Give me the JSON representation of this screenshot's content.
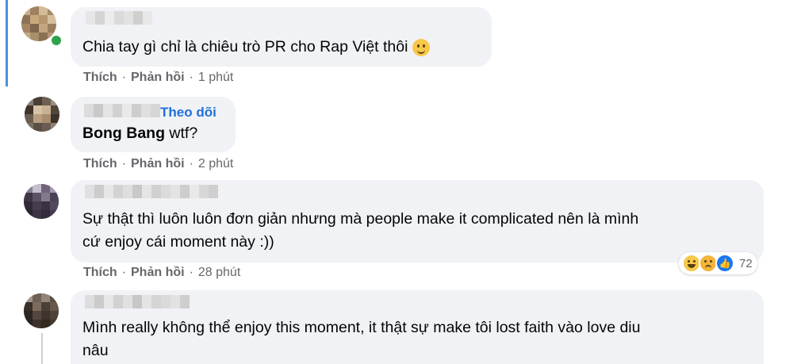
{
  "comments": [
    {
      "text": "Chia tay gì chỉ là chiêu trò PR cho Rap Việt thôi",
      "emoji": "slightly-smiling-face",
      "like": "Thích",
      "reply": "Phản hồi",
      "time": "1 phút"
    },
    {
      "follow": "Theo dõi",
      "mention": "Bong Bang",
      "text": " wtf?",
      "like": "Thích",
      "reply": "Phản hồi",
      "time": "2 phút"
    },
    {
      "line1": "Sự thật thì luôn luôn đơn giản nhưng mà people make it complicated nên là mình",
      "line2": "cứ enjoy cái moment này :))",
      "like": "Thích",
      "reply": "Phản hồi",
      "time": "28 phút",
      "reaction_count": "72",
      "reactions": [
        "haha-icon",
        "sad-icon",
        "like-icon"
      ]
    },
    {
      "line1": "Mình really không thể enjoy this moment, it thật sự make tôi lost faith vào love diu",
      "line2": "nâu"
    }
  ],
  "separator": "·",
  "colors": {
    "link": "#216fdb",
    "bubble": "#f0f2f5",
    "meta": "#65676b",
    "online": "#31a24c",
    "accent_bar": "#4c8ce8"
  }
}
